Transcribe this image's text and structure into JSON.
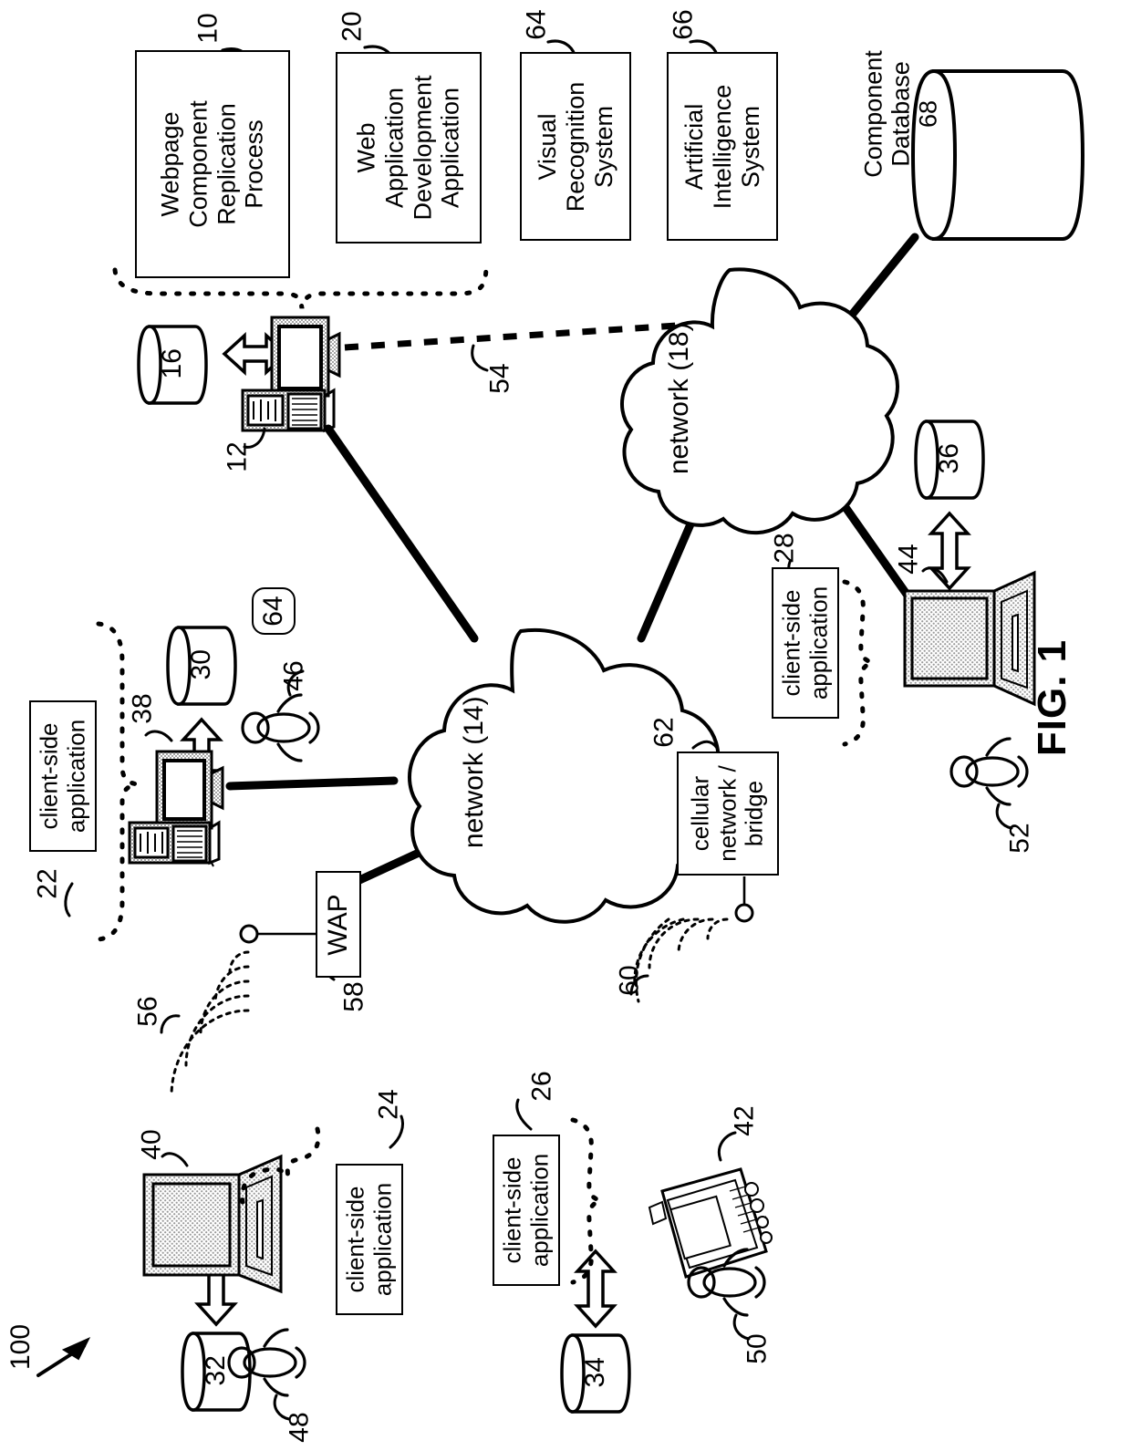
{
  "figure": {
    "title": "FIG. 1",
    "system_ref": "100"
  },
  "process_boxes": [
    {
      "label": "Webpage\nComponent\nReplication\nProcess",
      "ref": "10"
    },
    {
      "label": "Web\nApplication\nDevelopment\nApplication",
      "ref": "20"
    },
    {
      "label": "Visual\nRecognition\nSystem",
      "ref": "64"
    },
    {
      "label": "Artificial\nIntelligence\nSystem",
      "ref": "66"
    }
  ],
  "client_apps": [
    {
      "label": "client-side\napplication",
      "ref": "22"
    },
    {
      "label": "client-side\napplication",
      "ref": "24"
    },
    {
      "label": "client-side\napplication",
      "ref": "26"
    },
    {
      "label": "client-side\napplication",
      "ref": "28"
    }
  ],
  "networks": [
    {
      "label": "network (14)"
    },
    {
      "label": "network (18)"
    }
  ],
  "nodes": [
    {
      "name": "wap",
      "label": "WAP",
      "ref": "58"
    },
    {
      "name": "cellular-bridge",
      "label": "cellular\nnetwork /\nbridge",
      "ref": "62"
    }
  ],
  "database": {
    "label": "Component\nDatabase\n68"
  },
  "storage": [
    {
      "ref": "16"
    },
    {
      "ref": "30"
    },
    {
      "ref": "32"
    },
    {
      "ref": "34"
    },
    {
      "ref": "36"
    }
  ],
  "devices": [
    {
      "name": "server-computer",
      "ref": "12"
    },
    {
      "name": "desktop-client",
      "ref": "38"
    },
    {
      "name": "laptop-client-left",
      "ref": "40"
    },
    {
      "name": "pda-client",
      "ref": "42"
    },
    {
      "name": "laptop-client-right",
      "ref": "44"
    }
  ],
  "users": [
    {
      "ref": "46"
    },
    {
      "ref": "48"
    },
    {
      "ref": "50"
    },
    {
      "ref": "52"
    }
  ],
  "links": [
    {
      "name": "server-network-link",
      "ref": "54"
    },
    {
      "name": "wap-wireless",
      "ref": "56"
    },
    {
      "name": "cellular-wireless",
      "ref": "60"
    }
  ],
  "standalone_boxes": [
    {
      "label": "64"
    }
  ],
  "colors": {
    "stroke": "#000000",
    "background": "#ffffff",
    "screen_fill": "#cfcfcf"
  }
}
